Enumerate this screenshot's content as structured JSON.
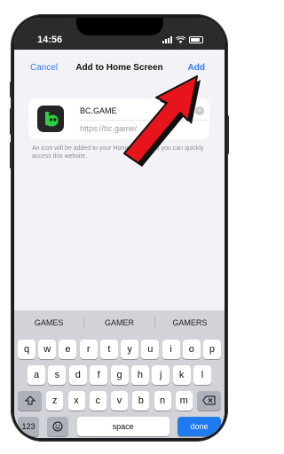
{
  "status_bar": {
    "time": "14:56"
  },
  "nav": {
    "cancel_label": "Cancel",
    "title": "Add to Home Screen",
    "add_label": "Add"
  },
  "app": {
    "name": "BC.GAME",
    "url": "https://bc.game/",
    "icon": "bc-game-logo-icon",
    "icon_color": "#2ecc40"
  },
  "caption": "An icon will be added to your Home Screen so you can quickly access this website.",
  "keyboard": {
    "suggestions": [
      "GAMES",
      "GAMER",
      "GAMERS"
    ],
    "row1": [
      "q",
      "w",
      "e",
      "r",
      "t",
      "y",
      "u",
      "i",
      "o",
      "p"
    ],
    "row2": [
      "a",
      "s",
      "d",
      "f",
      "g",
      "h",
      "j",
      "k",
      "l"
    ],
    "row3": [
      "z",
      "x",
      "c",
      "v",
      "b",
      "n",
      "m"
    ],
    "num_label": "123",
    "space_label": "space",
    "done_label": "done",
    "done_color": "#1f7bef"
  },
  "annotation": {
    "arrow_color": "#e8141b"
  }
}
